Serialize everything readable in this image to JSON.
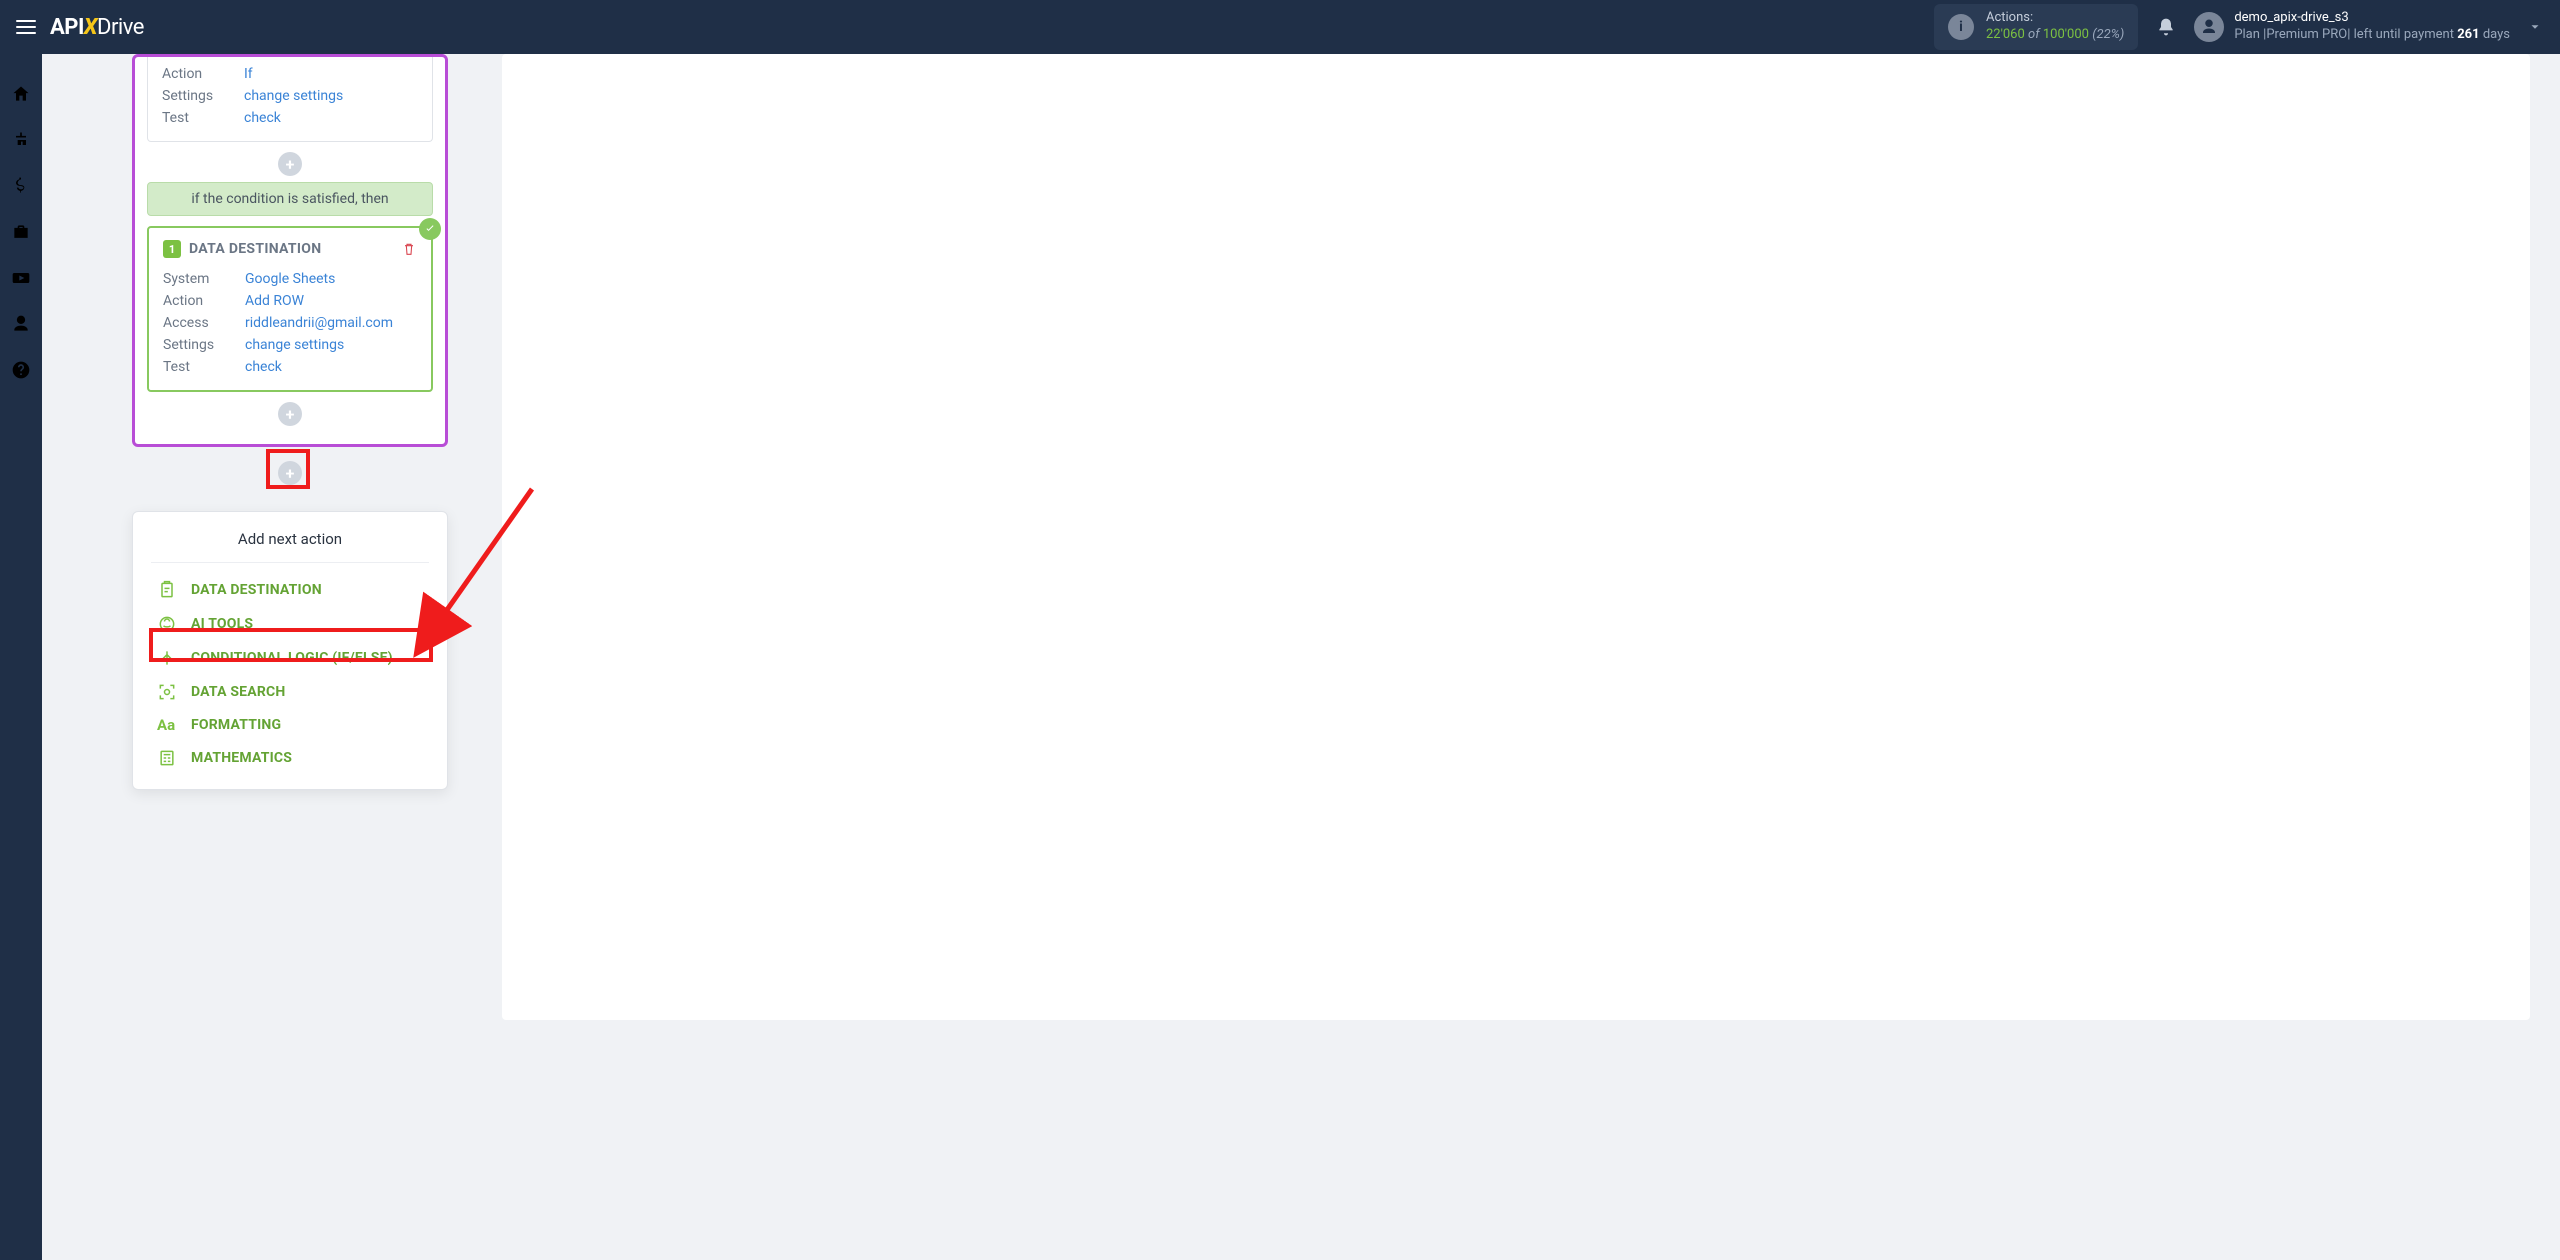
{
  "header": {
    "logo": {
      "api": "API",
      "x": "X",
      "drive": "Drive"
    },
    "actions": {
      "label": "Actions:",
      "current": "22'060",
      "of": "of",
      "max": "100'000",
      "percent": "(22%)"
    },
    "user": {
      "name": "demo_apix-drive_s3",
      "plan_prefix": "Plan |",
      "plan_name": "Premium PRO",
      "plan_mid": "| left until payment ",
      "days": "261",
      "days_suffix": " days"
    }
  },
  "card1": {
    "rows": [
      {
        "k": "Action",
        "v": "If"
      },
      {
        "k": "Settings",
        "v": "change settings"
      },
      {
        "k": "Test",
        "v": "check"
      }
    ]
  },
  "cond_banner": "if the condition is satisfied, then",
  "dest": {
    "badge": "1",
    "title": "DATA DESTINATION",
    "rows": [
      {
        "k": "System",
        "v": "Google Sheets"
      },
      {
        "k": "Action",
        "v": "Add ROW"
      },
      {
        "k": "Access",
        "v": "riddleandrii@gmail.com"
      },
      {
        "k": "Settings",
        "v": "change settings"
      },
      {
        "k": "Test",
        "v": "check"
      }
    ]
  },
  "popover": {
    "title": "Add next action",
    "items": [
      {
        "label": "DATA DESTINATION",
        "icon": "clipboard"
      },
      {
        "label": "AI TOOLS",
        "icon": "brain"
      },
      {
        "label": "CONDITIONAL LOGIC (IF/ELSE)",
        "icon": "branch"
      },
      {
        "label": "DATA SEARCH",
        "icon": "scan"
      },
      {
        "label": "FORMATTING",
        "icon": "aa"
      },
      {
        "label": "MATHEMATICS",
        "icon": "calc"
      }
    ]
  }
}
